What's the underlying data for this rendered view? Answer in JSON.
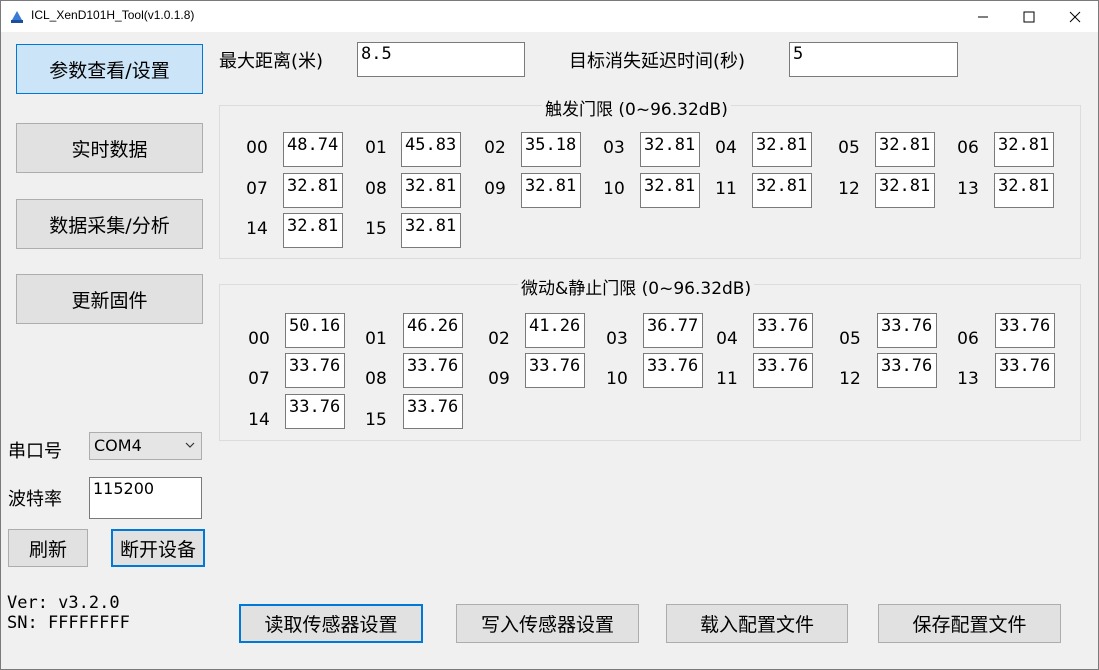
{
  "window": {
    "title": "ICL_XenD101H_Tool(v1.0.1.8)"
  },
  "sidebar": {
    "buttons": [
      {
        "label": "参数查看/设置"
      },
      {
        "label": "实时数据"
      },
      {
        "label": "数据采集/分析"
      },
      {
        "label": "更新固件"
      }
    ],
    "port_label": "串口号",
    "port_value": "COM4",
    "baud_label": "波特率",
    "baud_value": "115200",
    "refresh_label": "刷新",
    "disconnect_label": "断开设备",
    "version": "Ver: v3.2.0",
    "sn": "SN: FFFFFFFF"
  },
  "params": {
    "max_distance_label": "最大距离(米)",
    "max_distance_value": "8.5",
    "delay_label": "目标消失延迟时间(秒)",
    "delay_value": "5"
  },
  "trigger": {
    "title": "触发门限 (0~96.32dB)",
    "cells": [
      {
        "idx": "00",
        "val": "48.74"
      },
      {
        "idx": "01",
        "val": "45.83"
      },
      {
        "idx": "02",
        "val": "35.18"
      },
      {
        "idx": "03",
        "val": "32.81"
      },
      {
        "idx": "04",
        "val": "32.81"
      },
      {
        "idx": "05",
        "val": "32.81"
      },
      {
        "idx": "06",
        "val": "32.81"
      },
      {
        "idx": "07",
        "val": "32.81"
      },
      {
        "idx": "08",
        "val": "32.81"
      },
      {
        "idx": "09",
        "val": "32.81"
      },
      {
        "idx": "10",
        "val": "32.81"
      },
      {
        "idx": "11",
        "val": "32.81"
      },
      {
        "idx": "12",
        "val": "32.81"
      },
      {
        "idx": "13",
        "val": "32.81"
      },
      {
        "idx": "14",
        "val": "32.81"
      },
      {
        "idx": "15",
        "val": "32.81"
      }
    ]
  },
  "motion": {
    "title": "微动&静止门限 (0~96.32dB)",
    "cells": [
      {
        "idx": "00",
        "val": "50.16"
      },
      {
        "idx": "01",
        "val": "46.26"
      },
      {
        "idx": "02",
        "val": "41.26"
      },
      {
        "idx": "03",
        "val": "36.77"
      },
      {
        "idx": "04",
        "val": "33.76"
      },
      {
        "idx": "05",
        "val": "33.76"
      },
      {
        "idx": "06",
        "val": "33.76"
      },
      {
        "idx": "07",
        "val": "33.76"
      },
      {
        "idx": "08",
        "val": "33.76"
      },
      {
        "idx": "09",
        "val": "33.76"
      },
      {
        "idx": "10",
        "val": "33.76"
      },
      {
        "idx": "11",
        "val": "33.76"
      },
      {
        "idx": "12",
        "val": "33.76"
      },
      {
        "idx": "13",
        "val": "33.76"
      },
      {
        "idx": "14",
        "val": "33.76"
      },
      {
        "idx": "15",
        "val": "33.76"
      }
    ]
  },
  "footer": {
    "read_label": "读取传感器设置",
    "write_label": "写入传感器设置",
    "load_label": "载入配置文件",
    "save_label": "保存配置文件"
  }
}
